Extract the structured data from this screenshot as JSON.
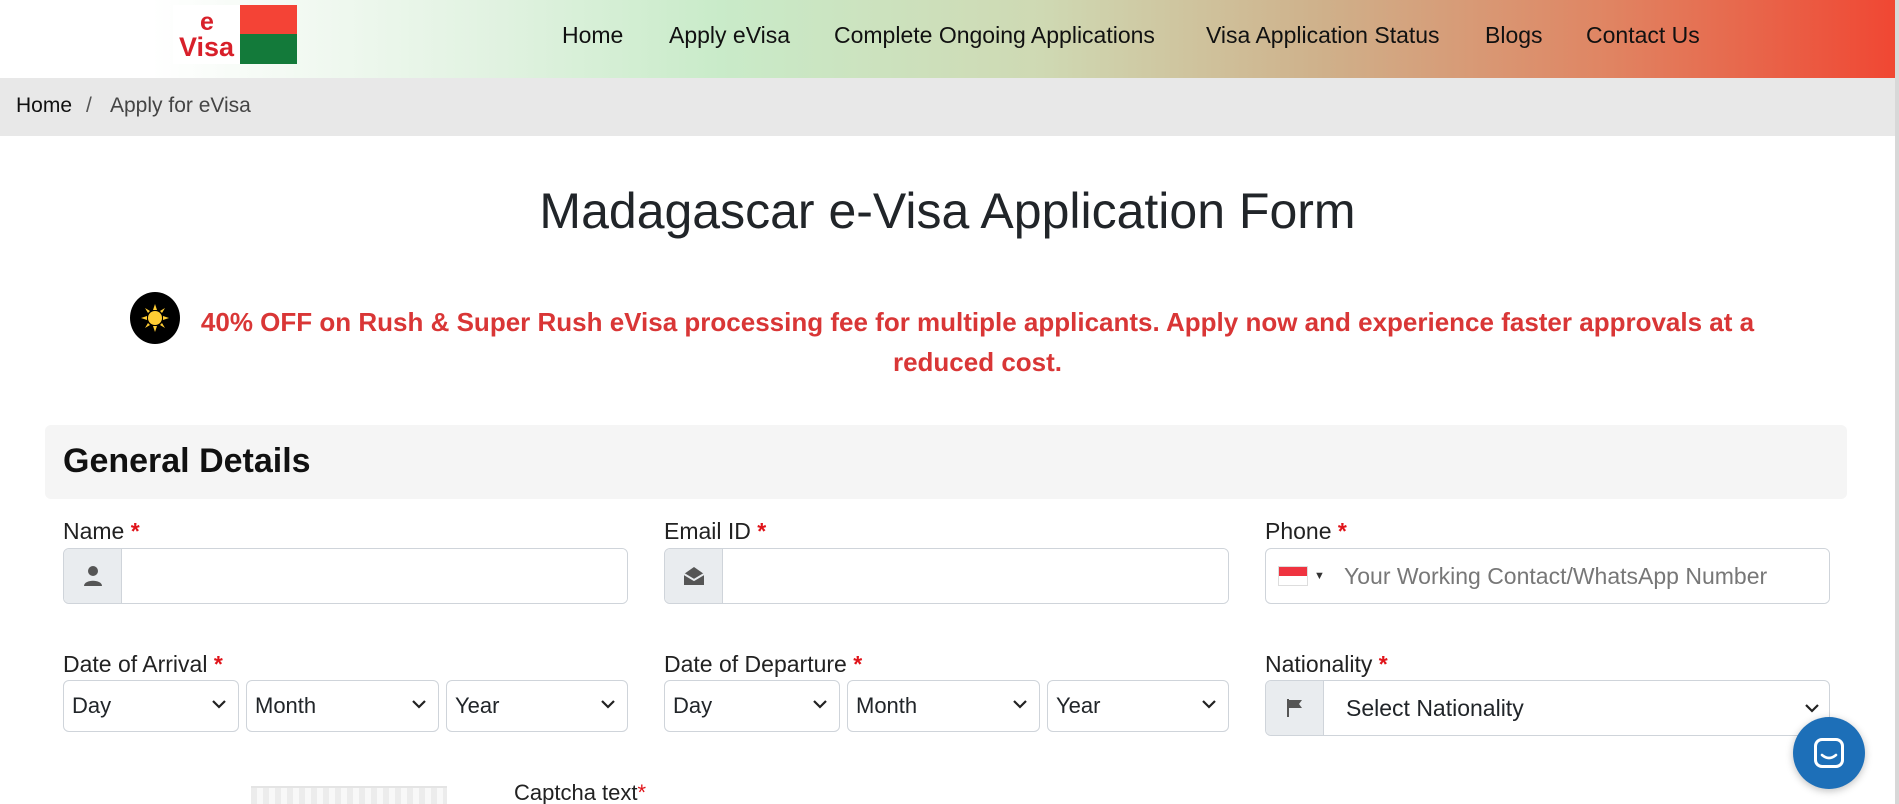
{
  "header": {
    "logo": {
      "line1": "e",
      "line2": "Visa"
    },
    "nav": [
      "Home",
      "Apply eVisa",
      "Complete Ongoing Applications",
      "Visa Application Status",
      "Blogs",
      "Contact Us"
    ]
  },
  "breadcrumb": {
    "home": "Home",
    "separator": "/",
    "current": "Apply for eVisa"
  },
  "page": {
    "title": "Madagascar e-Visa Application Form",
    "promo_icon": "sun-icon",
    "promo": "40% OFF on Rush & Super Rush eVisa processing fee for multiple applicants. Apply now and experience faster approvals at a reduced cost."
  },
  "form": {
    "section_title": "General Details",
    "required_mark": "*",
    "name": {
      "label": "Name",
      "value": "",
      "icon": "user-icon"
    },
    "email": {
      "label": "Email ID",
      "value": "",
      "icon": "envelope-icon"
    },
    "phone": {
      "label": "Phone",
      "placeholder": "Your Working Contact/WhatsApp Number",
      "country_flag": "singapore-flag"
    },
    "arrival": {
      "label": "Date of Arrival",
      "day": "Day",
      "month": "Month",
      "year": "Year"
    },
    "departure": {
      "label": "Date of Departure",
      "day": "Day",
      "month": "Month",
      "year": "Year"
    },
    "nationality": {
      "label": "Nationality",
      "selected": "Select Nationality",
      "icon": "flag-icon"
    },
    "captcha": {
      "label": "Captcha text",
      "required_mark": "*"
    }
  },
  "chat": {
    "icon": "chat-icon"
  },
  "colors": {
    "promo_red": "#d93636",
    "required_red": "#e0141a",
    "chat_blue": "#1d6fb8"
  }
}
